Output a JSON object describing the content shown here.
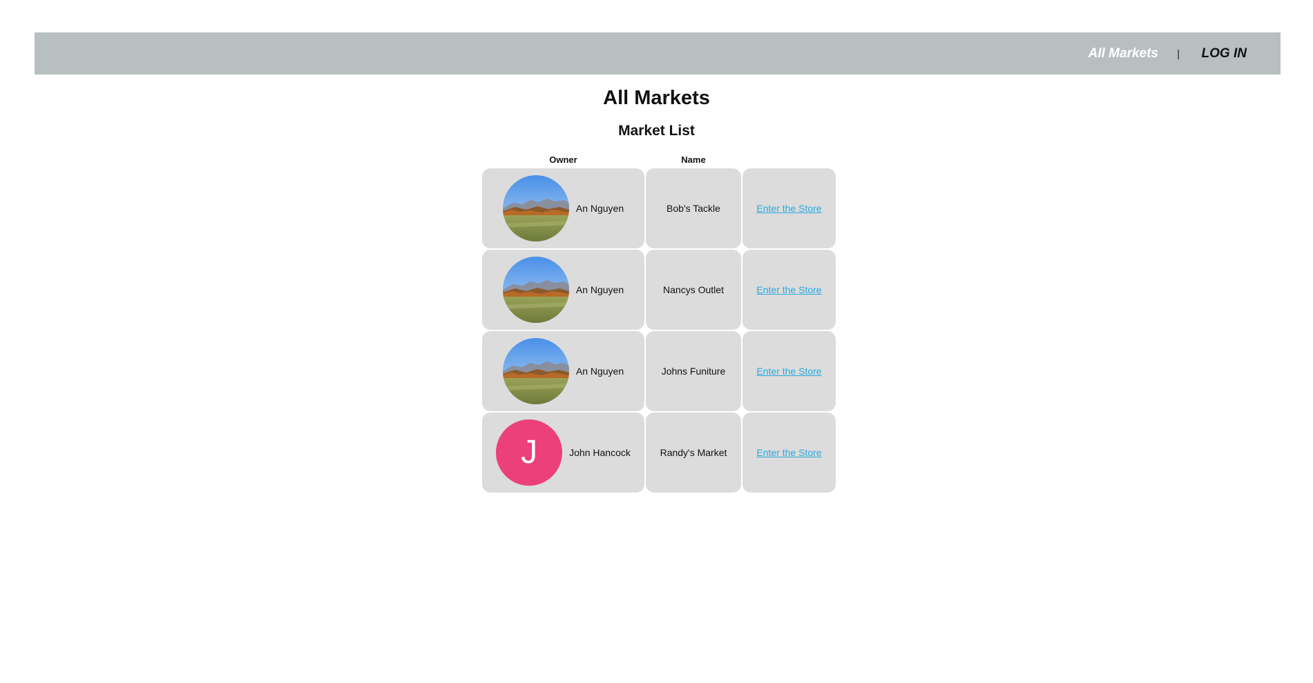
{
  "nav": {
    "all_markets": "All Markets",
    "separator": "|",
    "login": "LOG IN"
  },
  "page": {
    "title": "All Markets",
    "section_title": "Market List"
  },
  "table": {
    "headers": {
      "owner": "Owner",
      "name": "Name"
    },
    "rows": [
      {
        "owner": "An Nguyen",
        "avatar": "landscape-photo",
        "name": "Bob's Tackle",
        "link": "Enter the Store"
      },
      {
        "owner": "An Nguyen",
        "avatar": "landscape-photo",
        "name": "Nancys Outlet",
        "link": "Enter the Store"
      },
      {
        "owner": "An Nguyen",
        "avatar": "landscape-photo",
        "name": "Johns Funiture",
        "link": "Enter the Store"
      },
      {
        "owner": "John Hancock",
        "avatar_letter": "J",
        "avatar_color": "#ec407a",
        "name": "Randy's Market",
        "link": "Enter the Store"
      }
    ]
  },
  "colors": {
    "navbar": "#b8bfc1",
    "cell": "#dcdcdc",
    "link": "#29a9e0"
  }
}
